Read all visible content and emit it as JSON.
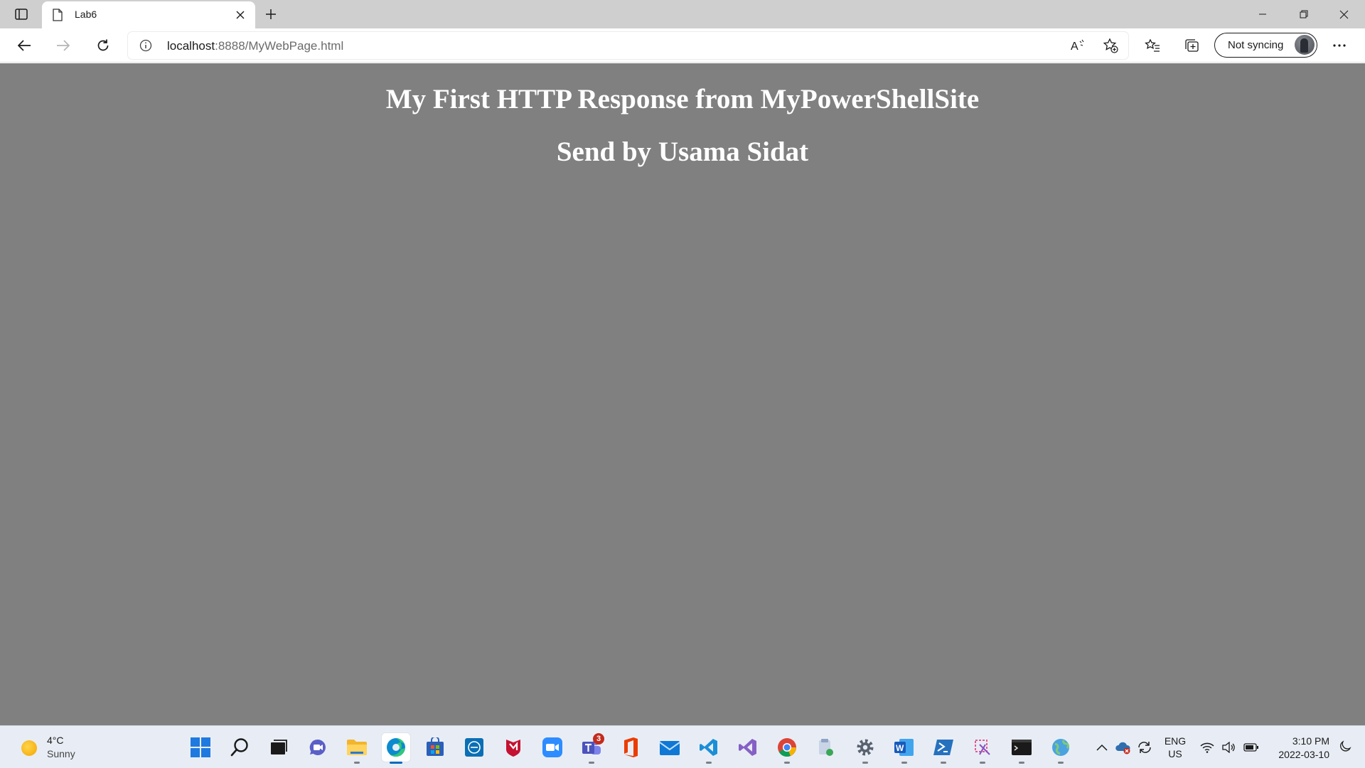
{
  "browser": {
    "tab": {
      "title": "Lab6"
    },
    "address": {
      "host": "localhost",
      "path": ":8888/MyWebPage.html"
    },
    "profile": {
      "sync_label": "Not syncing"
    }
  },
  "page": {
    "heading1": "My First HTTP Response from MyPowerShellSite",
    "heading2": "Send by Usama Sidat",
    "background": "#808080"
  },
  "taskbar": {
    "weather": {
      "temp": "4°C",
      "condition": "Sunny",
      "icon": "sun-icon"
    },
    "apps": [
      {
        "name": "start-button",
        "icon": "windows-logo-icon"
      },
      {
        "name": "search-button",
        "icon": "search-icon"
      },
      {
        "name": "task-view-button",
        "icon": "task-view-icon"
      },
      {
        "name": "chat-button",
        "icon": "chat-icon"
      },
      {
        "name": "file-explorer-app",
        "icon": "folder-icon"
      },
      {
        "name": "edge-app",
        "icon": "edge-icon",
        "active": true
      },
      {
        "name": "store-app",
        "icon": "store-icon"
      },
      {
        "name": "dell-app",
        "icon": "dell-icon"
      },
      {
        "name": "mcafee-app",
        "icon": "mcafee-icon"
      },
      {
        "name": "zoom-app",
        "icon": "video-camera-icon"
      },
      {
        "name": "teams-app",
        "icon": "teams-icon",
        "badge": "3"
      },
      {
        "name": "office-app",
        "icon": "office-icon"
      },
      {
        "name": "mail-app",
        "icon": "mail-icon"
      },
      {
        "name": "vscode-app",
        "icon": "vscode-icon"
      },
      {
        "name": "visual-studio-app",
        "icon": "visual-studio-icon"
      },
      {
        "name": "chrome-app",
        "icon": "chrome-icon"
      },
      {
        "name": "installer-app",
        "icon": "installer-icon"
      },
      {
        "name": "settings-app",
        "icon": "gear-icon"
      },
      {
        "name": "word-app",
        "icon": "word-icon"
      },
      {
        "name": "powershell-app",
        "icon": "powershell-icon"
      },
      {
        "name": "snipping-tool-app",
        "icon": "snipping-icon"
      },
      {
        "name": "terminal-app",
        "icon": "terminal-icon"
      },
      {
        "name": "network-app",
        "icon": "globe-icon"
      }
    ],
    "tray": {
      "language": "ENG",
      "region": "US",
      "time": "3:10 PM",
      "date": "2022-03-10"
    }
  },
  "colors": {
    "accent": "#0067c0",
    "page_bg": "#808080",
    "taskbar_bg": "#e8edf5",
    "tabstrip_bg": "#cfcfcf"
  }
}
